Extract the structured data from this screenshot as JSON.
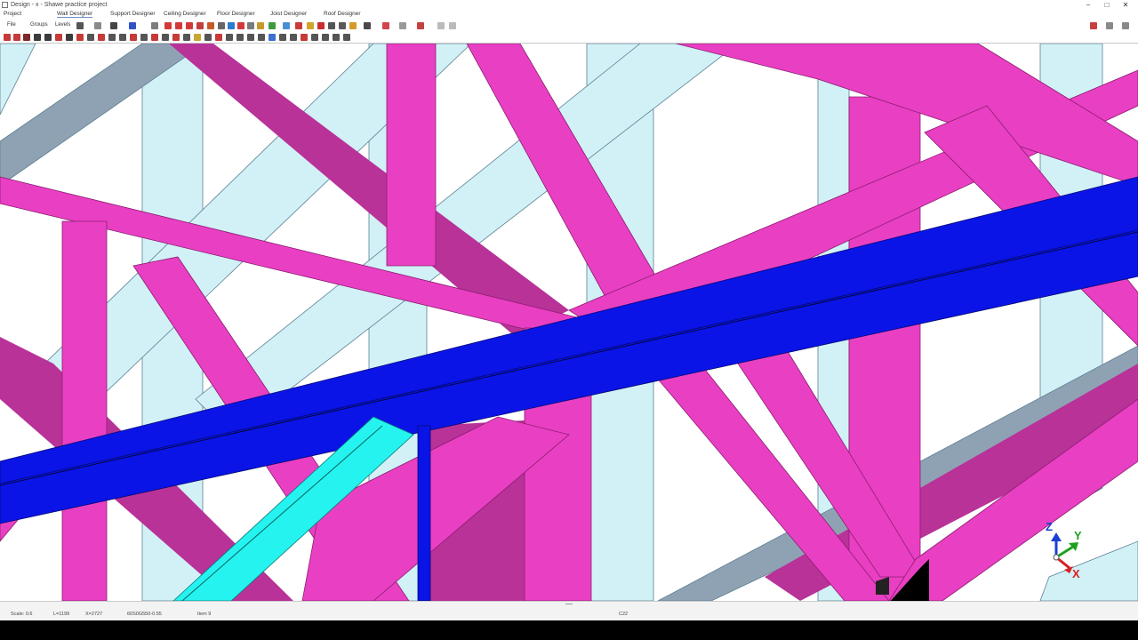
{
  "window": {
    "title": "Design - x - Shawe practice project",
    "controls": {
      "minimize": "–",
      "maximize": "□",
      "close": "✕"
    }
  },
  "menu": {
    "project": "Project",
    "wall_designer": "Wall Designer",
    "support_designer": "Support Designer",
    "ceiling_designer": "Ceiling Designer",
    "floor_designer": "Floor Designer",
    "joist_designer": "Joist Designer",
    "roof_designer": "Roof Designer"
  },
  "toolbar": {
    "file": "File",
    "groups": "Groups",
    "levels": "Levels"
  },
  "axis": {
    "z": "Z",
    "y": "Y",
    "x": "X"
  },
  "status": {
    "scale": "Scale: 0.6",
    "length": "L=1199",
    "x_coord": "X=2727",
    "section": "60S0G550-0.55",
    "item": "Item 9",
    "code": "C22"
  },
  "colors": {
    "stud_magenta": "#e93fc3",
    "stud_shadow": "#b83298",
    "beam_blue": "#0a14e6",
    "beam_cyan": "#25f3ef",
    "ghost_lightblue": "#d2f1f7",
    "ghost_steel": "#8fa2b3"
  }
}
